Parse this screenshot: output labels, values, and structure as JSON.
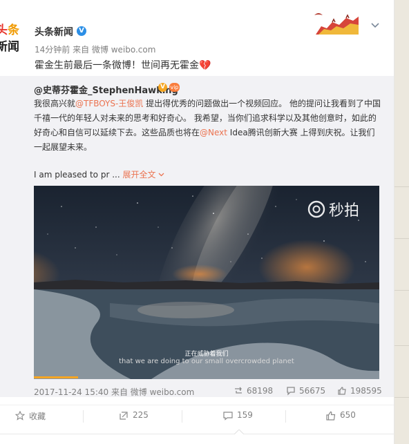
{
  "post": {
    "avatar_line1_a": "头",
    "avatar_line1_b": "条",
    "avatar_line2": "新闻",
    "username": "头条新闻",
    "meta": "14分钟前 来自 微博 weibo.com",
    "text": "霍金生前最后一条微博！世间再无霍金",
    "icons": {
      "verified": "verified-badge-icon",
      "menu": "chevron-down-icon",
      "emoji": "broken-heart-icon"
    }
  },
  "original": {
    "username": "@史蒂芬霍金_StephenHawking",
    "text_parts": {
      "p1": "我很高兴就",
      "mention1": "@TFBOYS-王俊凯",
      "p2": " 提出得优秀的问题做出一个视频回应。 他的提问让我看到了中国千禧一代的年轻人对未来的思考和好奇心。 我希望，当你们追求科学以及其他创意时，如此的好奇心和自信可以延续下去。这些品质也将在",
      "mention2": "@Next",
      "p3": " Idea腾讯创新大赛 上得到庆祝。让我们一起展望未来。"
    },
    "en_preview": "I am pleased to pr ... ",
    "expand_label": "展开全文",
    "video": {
      "watermark": "秒拍",
      "subtitle_zh": "正在威胁着我们",
      "subtitle_en": "that we are doing to our small overcrowded planet"
    },
    "meta": "2017-11-24 15:40 来自 微博 weibo.com",
    "stats": {
      "reposts": "68198",
      "comments": "56675",
      "likes": "198595"
    }
  },
  "actions": {
    "favorite": "收藏",
    "repost": "225",
    "comment": "159",
    "like": "650"
  },
  "colors": {
    "link": "#eb7350",
    "verified": "#2c8fe6",
    "repost_bg": "#f2f2f5",
    "meta": "#808080"
  }
}
